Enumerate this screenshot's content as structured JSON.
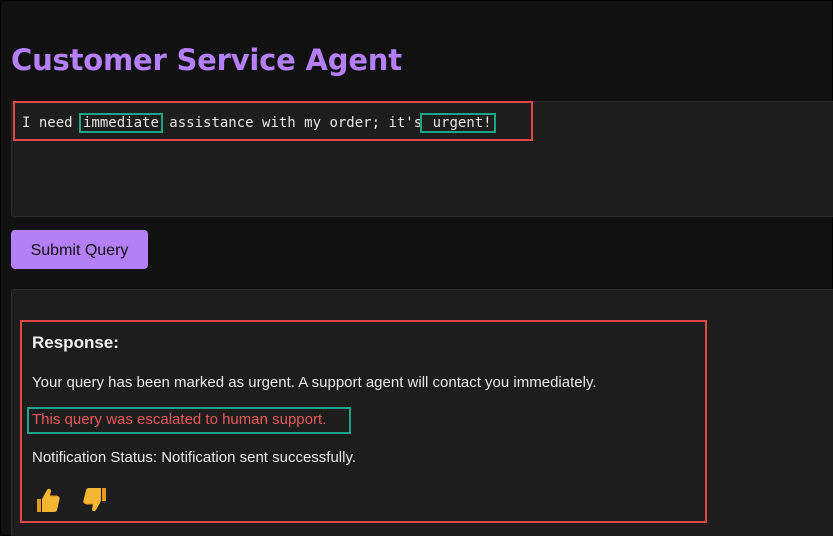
{
  "app": {
    "title": "Customer Service Agent"
  },
  "query": {
    "parts": [
      {
        "text": "I need ",
        "highlight": false
      },
      {
        "text": "immediate",
        "highlight": true
      },
      {
        "text": " assistance with my order; it's",
        "highlight": false
      },
      {
        "text": " urgent!",
        "highlight": true
      }
    ]
  },
  "submit": {
    "label": "Submit Query"
  },
  "response": {
    "heading": "Response:",
    "message": "Your query has been marked as urgent. A support agent will contact you immediately.",
    "escalation": "This query was escalated to human support.",
    "notification": "Notification Status: Notification sent successfully."
  },
  "feedback": {
    "up_icon": "thumbs-up-icon",
    "down_icon": "thumbs-down-icon"
  },
  "colors": {
    "accent": "#b47ff7",
    "highlight_red": "#e04848",
    "highlight_green": "#1aa58a",
    "escalation_text": "#ec5858",
    "background": "#111111",
    "panel": "#1d1d1d"
  }
}
